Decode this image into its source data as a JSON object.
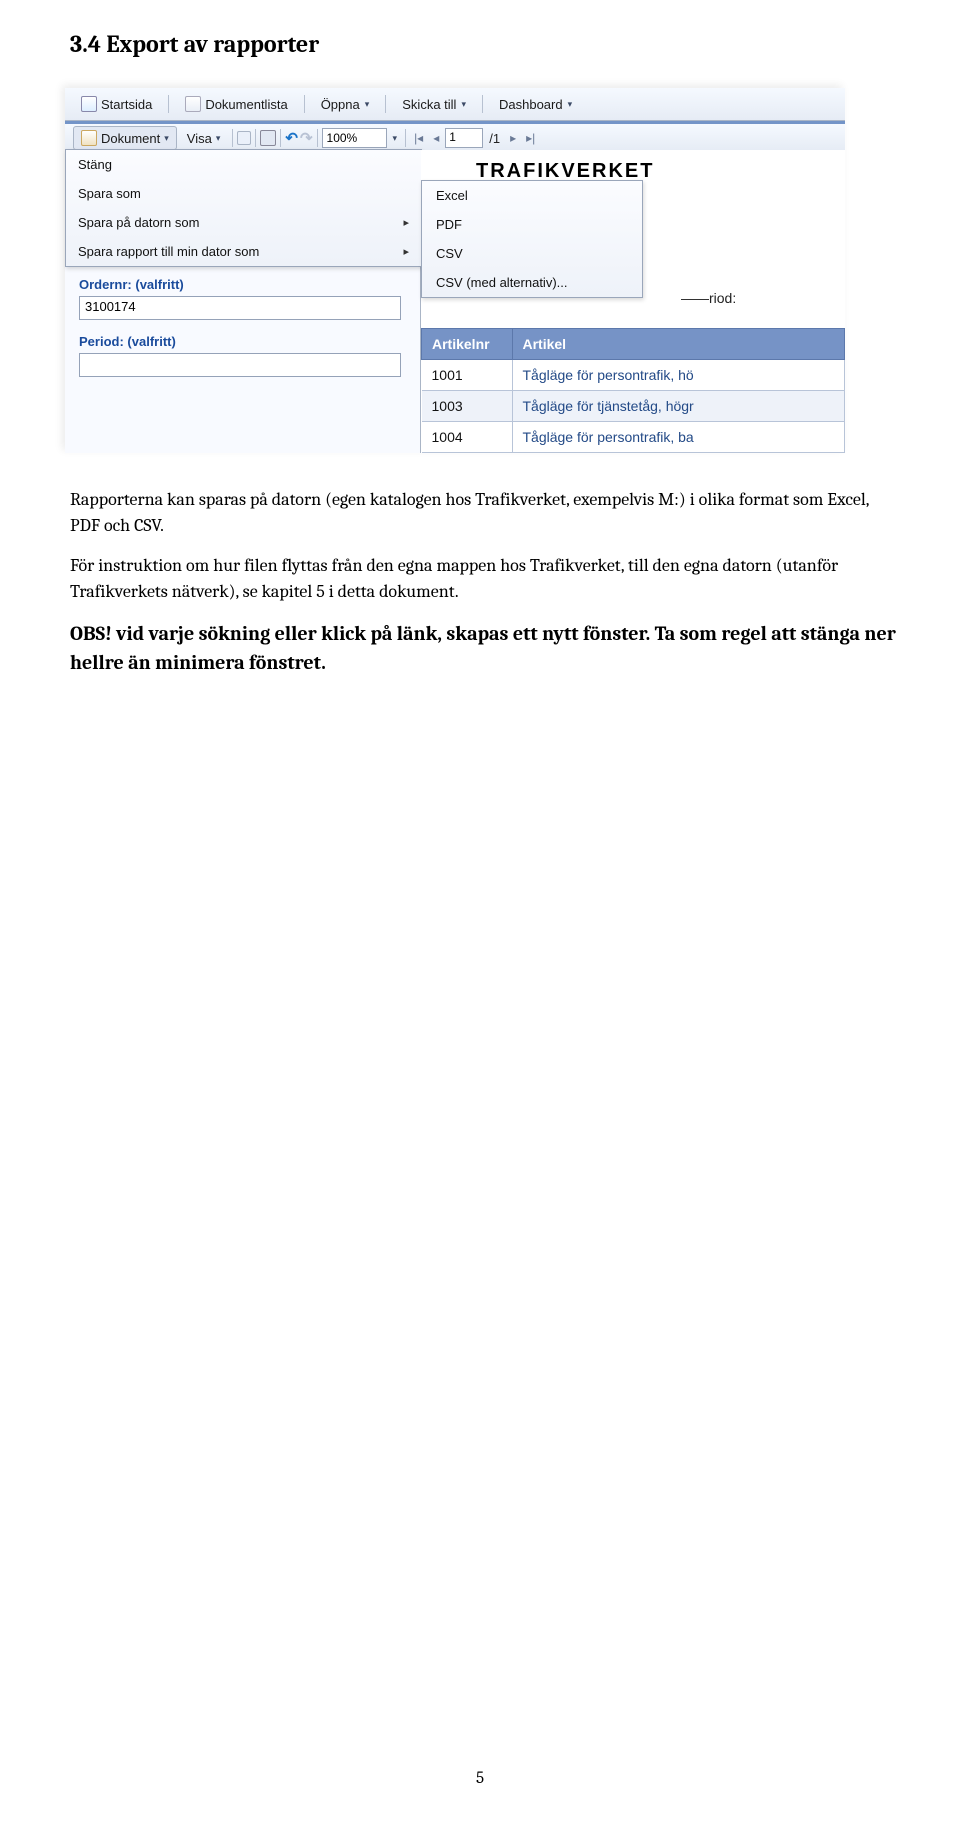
{
  "section_title": "3.4 Export av rapporter",
  "toolbar_top": {
    "home": "Startsida",
    "doclist": "Dokumentlista",
    "open": "Öppna",
    "send_to": "Skicka till",
    "dashboard": "Dashboard"
  },
  "toolbar2": {
    "document": "Dokument",
    "view": "Visa",
    "zoom_value": "100%",
    "page_current": "1",
    "page_total": "/1"
  },
  "doc_menu": {
    "close": "Stäng",
    "save_as": "Spara som",
    "save_local_as": "Spara på datorn som",
    "save_report_local_as": "Spara rapport till min dator som"
  },
  "export_submenu": {
    "excel": "Excel",
    "pdf": "PDF",
    "csv": "CSV",
    "csv_opts": "CSV (med alternativ)..."
  },
  "form": {
    "ordernr_label": "Ordernr:",
    "ordernr_opt": "(valfritt)",
    "ordernr_value": "3100174",
    "period_label": "Period:",
    "period_opt": "(valfritt)",
    "period_value": ""
  },
  "brand": "TRAFIKVERKET",
  "ghost": {
    "prefix": "———: ",
    "orderval": "",
    "period_prefix": "——riod:"
  },
  "table": {
    "headers": {
      "artikelnr": "Artikelnr",
      "artikel": "Artikel"
    },
    "rows": [
      {
        "nr": "1001",
        "artikel": "Tågläge för persontrafik, hö"
      },
      {
        "nr": "1003",
        "artikel": "Tågläge för tjänstetåg, högr"
      },
      {
        "nr": "1004",
        "artikel": "Tågläge för persontrafik, ba"
      }
    ]
  },
  "paragraphs": {
    "p1": "Rapporterna kan sparas på datorn (egen katalogen hos Trafikverket, exempelvis M:) i olika format som Excel, PDF och CSV.",
    "p2": "För instruktion om hur filen flyttas från den egna mappen hos Trafikverket, till den egna datorn (utanför Trafikverkets nätverk), se kapitel 5 i detta dokument.",
    "obs": "OBS! vid varje sökning eller klick på länk, skapas ett nytt fönster. Ta som regel att stänga ner hellre än minimera fönstret."
  },
  "page_number": "5"
}
